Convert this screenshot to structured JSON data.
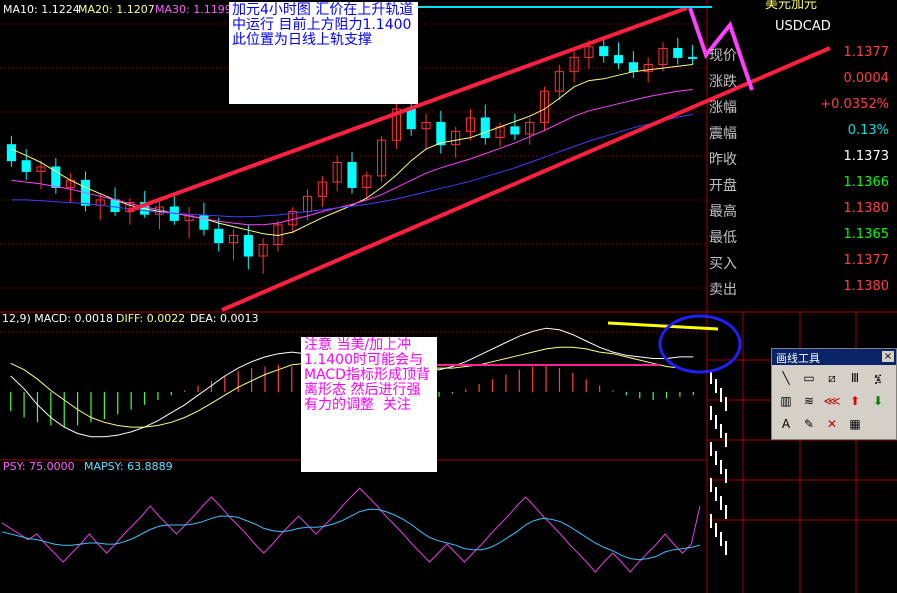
{
  "main_labels": {
    "ma10": "MA10: 1.1224",
    "ma20": "MA20: 1.1207",
    "ma30": "MA30: 1.1199"
  },
  "macd_label": {
    "params": "12,9) MACD: 0.0018",
    "diff": "DIFF: 0.0022",
    "dea": "DEA: 0.0013"
  },
  "psy_label": {
    "psy": "PSY: 75.0000",
    "mapsy": "MAPSY: 63.8889"
  },
  "quote": {
    "title": "美元加元",
    "symbol": "USDCAD",
    "rows": [
      {
        "label": "现价",
        "value": "1.1377",
        "color": "#ff4040"
      },
      {
        "label": "涨跌",
        "value": "0.0004",
        "color": "#ff4040"
      },
      {
        "label": "涨幅",
        "value": "+0.0352%",
        "color": "#ff4040"
      },
      {
        "label": "震幅",
        "value": "0.13%",
        "color": "#00e0e0"
      },
      {
        "label": "昨收",
        "value": "1.1373",
        "color": "#ffffff"
      },
      {
        "label": "开盘",
        "value": "1.1366",
        "color": "#00ff00"
      },
      {
        "label": "最高",
        "value": "1.1380",
        "color": "#ff4040"
      },
      {
        "label": "最低",
        "value": "1.1365",
        "color": "#00ff00"
      },
      {
        "label": "买入",
        "value": "1.1377",
        "color": "#ff4040"
      },
      {
        "label": "卖出",
        "value": "1.1380",
        "color": "#ff4040"
      }
    ]
  },
  "annotations": {
    "top": "加元4小时图 汇价在上升轨道中运行 目前上方阻力1.1400 此位置为日线上轨支撑",
    "bottom": "注意 当美/加上冲1.1400时可能会与MACD指标形成顶背离形态 然后进行强有力的调整  关注"
  },
  "toolbox": {
    "title": "画线工具",
    "close": "×",
    "tools": [
      "line-tool-icon",
      "rect-tool-icon",
      "parallel-tool-icon",
      "bars-tool-icon",
      "fib-tool-icon",
      "gann-tool-icon",
      "channel-tool-icon",
      "fan-tool-icon",
      "up-arrow-icon",
      "down-arrow-icon",
      "text-tool-icon",
      "erase-tool-icon",
      "delete-tool-icon",
      "save-tool-icon"
    ],
    "text_tool": "A"
  },
  "colors": {
    "up_candle": "#ff3030",
    "down_candle": "#00ffff",
    "ma10": "#ffff80",
    "ma20": "#ff40ff",
    "ma30": "#4040ff",
    "trend": "#ff2040",
    "resistance": "#00e0ff",
    "grid": "#8b0000"
  },
  "chart_data": [
    {
      "type": "candlestick",
      "title": "",
      "ylim": [
        1.11,
        1.142
      ],
      "series": [
        {
          "name": "MA10",
          "values": [
            1.1275,
            1.1268,
            1.126,
            1.125,
            1.124,
            1.1232,
            1.1225,
            1.1218,
            1.1212,
            1.1208,
            1.1205,
            1.1203,
            1.12,
            1.1197,
            1.1192,
            1.1188,
            1.1184,
            1.118,
            1.1178,
            1.1182,
            1.119,
            1.1198,
            1.1205,
            1.1212,
            1.122,
            1.1232,
            1.1246,
            1.1262,
            1.1275,
            1.1282,
            1.1285,
            1.1288,
            1.1294,
            1.13,
            1.1306,
            1.1312,
            1.132,
            1.1332,
            1.1345,
            1.1352,
            1.1354,
            1.1358,
            1.1362,
            1.1364,
            1.1366,
            1.1368,
            1.137
          ]
        },
        {
          "name": "MA20",
          "values": [
            1.124,
            1.1238,
            1.1236,
            1.1233,
            1.123,
            1.1226,
            1.1222,
            1.1218,
            1.1214,
            1.121,
            1.1207,
            1.1203,
            1.12,
            1.1197,
            1.1194,
            1.1192,
            1.119,
            1.119,
            1.1192,
            1.1196,
            1.12,
            1.1205,
            1.1209,
            1.1213,
            1.1218,
            1.1224,
            1.1232,
            1.124,
            1.1248,
            1.1254,
            1.1259,
            1.1264,
            1.127,
            1.1276,
            1.1282,
            1.1289,
            1.1296,
            1.1304,
            1.1312,
            1.1318,
            1.1322,
            1.1326,
            1.133,
            1.1334,
            1.1337,
            1.134,
            1.1342
          ]
        },
        {
          "name": "MA30",
          "values": [
            1.1218,
            1.1218,
            1.1217,
            1.1216,
            1.1215,
            1.1214,
            1.1212,
            1.121,
            1.1208,
            1.1206,
            1.1204,
            1.1203,
            1.1202,
            1.1201,
            1.12,
            1.1199,
            1.1199,
            1.12,
            1.1201,
            1.1203,
            1.1205,
            1.1207,
            1.1209,
            1.1211,
            1.1213,
            1.1216,
            1.1219,
            1.1223,
            1.1227,
            1.1231,
            1.1235,
            1.1239,
            1.1244,
            1.1249,
            1.1254,
            1.126,
            1.1266,
            1.1272,
            1.1278,
            1.1284,
            1.1289,
            1.1294,
            1.1299,
            1.1303,
            1.1307,
            1.1311,
            1.1314
          ]
        }
      ],
      "candles": [
        [
          1.128,
          1.129,
          1.1255,
          1.1262
        ],
        [
          1.1262,
          1.1275,
          1.124,
          1.125
        ],
        [
          1.125,
          1.1262,
          1.123,
          1.1255
        ],
        [
          1.1255,
          1.1265,
          1.1225,
          1.1232
        ],
        [
          1.1232,
          1.1248,
          1.1215,
          1.124
        ],
        [
          1.124,
          1.125,
          1.1205,
          1.1212
        ],
        [
          1.1212,
          1.1225,
          1.1195,
          1.1218
        ],
        [
          1.1218,
          1.1232,
          1.12,
          1.1205
        ],
        [
          1.1205,
          1.122,
          1.119,
          1.1215
        ],
        [
          1.1215,
          1.1228,
          1.1198,
          1.1202
        ],
        [
          1.1202,
          1.1218,
          1.1185,
          1.121
        ],
        [
          1.121,
          1.1222,
          1.119,
          1.1195
        ],
        [
          1.1195,
          1.121,
          1.1175,
          1.12
        ],
        [
          1.12,
          1.1215,
          1.1178,
          1.1185
        ],
        [
          1.1185,
          1.1198,
          1.116,
          1.117
        ],
        [
          1.117,
          1.1185,
          1.115,
          1.1178
        ],
        [
          1.1178,
          1.119,
          1.114,
          1.1155
        ],
        [
          1.1155,
          1.1175,
          1.1135,
          1.1168
        ],
        [
          1.1168,
          1.1195,
          1.116,
          1.119
        ],
        [
          1.119,
          1.121,
          1.118,
          1.1205
        ],
        [
          1.1205,
          1.123,
          1.1195,
          1.1222
        ],
        [
          1.1222,
          1.1245,
          1.121,
          1.1238
        ],
        [
          1.1238,
          1.1268,
          1.1228,
          1.126
        ],
        [
          1.126,
          1.1272,
          1.1225,
          1.1232
        ],
        [
          1.1232,
          1.125,
          1.122,
          1.1245
        ],
        [
          1.1245,
          1.129,
          1.1238,
          1.1285
        ],
        [
          1.1285,
          1.133,
          1.1275,
          1.132
        ],
        [
          1.132,
          1.1335,
          1.129,
          1.1298
        ],
        [
          1.1298,
          1.1315,
          1.1275,
          1.1305
        ],
        [
          1.1305,
          1.1318,
          1.127,
          1.128
        ],
        [
          1.128,
          1.13,
          1.1265,
          1.1295
        ],
        [
          1.1295,
          1.132,
          1.1285,
          1.131
        ],
        [
          1.131,
          1.1325,
          1.128,
          1.1288
        ],
        [
          1.1288,
          1.1305,
          1.1278,
          1.13
        ],
        [
          1.13,
          1.1315,
          1.1285,
          1.1292
        ],
        [
          1.1292,
          1.131,
          1.128,
          1.1305
        ],
        [
          1.1305,
          1.1345,
          1.1295,
          1.134
        ],
        [
          1.134,
          1.137,
          1.133,
          1.1362
        ],
        [
          1.1362,
          1.1385,
          1.135,
          1.1378
        ],
        [
          1.1378,
          1.1398,
          1.1365,
          1.139
        ],
        [
          1.139,
          1.1402,
          1.1372,
          1.138
        ],
        [
          1.138,
          1.1395,
          1.1365,
          1.1372
        ],
        [
          1.1372,
          1.1385,
          1.1355,
          1.1362
        ],
        [
          1.1362,
          1.1378,
          1.135,
          1.137
        ],
        [
          1.137,
          1.1395,
          1.1362,
          1.1388
        ],
        [
          1.1388,
          1.14,
          1.137,
          1.1378
        ],
        [
          1.1378,
          1.1392,
          1.137,
          1.1377
        ]
      ],
      "resistance": 1.14
    },
    {
      "type": "bar",
      "title": "",
      "series": [
        {
          "name": "MACD",
          "values": [
            -0.0012,
            -0.0016,
            -0.0019,
            -0.0021,
            -0.0022,
            -0.0021,
            -0.0019,
            -0.0017,
            -0.0014,
            -0.0011,
            -0.0008,
            -0.0005,
            -0.0002,
            0.0001,
            0.0004,
            0.0007,
            0.001,
            0.0013,
            0.0015,
            0.0016,
            0.0017,
            0.0016,
            0.0014,
            0.0011,
            0.0008,
            0.0005,
            0.0003,
            0.0001,
            -0.0001,
            -0.0003,
            -0.0004,
            -0.0004,
            -0.0003,
            -0.0001,
            0.0002,
            0.0005,
            0.0008,
            0.0011,
            0.0014,
            0.0016,
            0.0017,
            0.0015,
            0.0012,
            0.0008,
            0.0004,
            0.0001,
            -0.0002,
            -0.0004,
            -0.0005,
            -0.0004,
            -0.0003,
            -0.0002
          ]
        },
        {
          "name": "DIFF",
          "values": [
            0.001,
            0.0002,
            -0.0008,
            -0.0016,
            -0.0022,
            -0.0026,
            -0.0028,
            -0.0028,
            -0.0027,
            -0.0025,
            -0.0022,
            -0.0018,
            -0.0013,
            -0.0008,
            -0.0002,
            0.0004,
            0.001,
            0.0015,
            0.0019,
            0.0022,
            0.0024,
            0.0025,
            0.0024,
            0.0022,
            0.002,
            0.0018,
            0.0016,
            0.0015,
            0.0014,
            0.0013,
            0.0013,
            0.0013,
            0.0014,
            0.0016,
            0.0019,
            0.0023,
            0.0027,
            0.0031,
            0.0035,
            0.0038,
            0.004,
            0.0039,
            0.0036,
            0.0032,
            0.0028,
            0.0025,
            0.0023,
            0.0022,
            0.0021,
            0.0021,
            0.0022,
            0.0022
          ]
        },
        {
          "name": "DEA",
          "values": [
            0.0018,
            0.0014,
            0.0008,
            0.0001,
            -0.0005,
            -0.0011,
            -0.0016,
            -0.0019,
            -0.0021,
            -0.0022,
            -0.0022,
            -0.0021,
            -0.0019,
            -0.0016,
            -0.0012,
            -0.0007,
            -0.0002,
            0.0003,
            0.0007,
            0.0011,
            0.0014,
            0.0017,
            0.0018,
            0.0019,
            0.0019,
            0.0019,
            0.0018,
            0.0018,
            0.0017,
            0.0016,
            0.0015,
            0.0015,
            0.0015,
            0.0015,
            0.0016,
            0.0017,
            0.0019,
            0.0021,
            0.0023,
            0.0025,
            0.0027,
            0.0028,
            0.0028,
            0.0027,
            0.0025,
            0.0024,
            0.0022,
            0.002,
            0.0018,
            0.0016,
            0.0015,
            0.0013
          ]
        }
      ]
    },
    {
      "type": "line",
      "title": "",
      "ylim": [
        0,
        100
      ],
      "series": [
        {
          "name": "PSY",
          "values": [
            60,
            55,
            50,
            45,
            50,
            41,
            33,
            25,
            33,
            41,
            50,
            41,
            33,
            41,
            50,
            58,
            66,
            75,
            66,
            58,
            50,
            58,
            66,
            75,
            83,
            75,
            66,
            58,
            50,
            41,
            33,
            41,
            50,
            58,
            66,
            58,
            50,
            58,
            66,
            75,
            83,
            91,
            83,
            75,
            66,
            58,
            50,
            41,
            33,
            25,
            33,
            41,
            33,
            25,
            33,
            41,
            50,
            58,
            66,
            75,
            83,
            75,
            66,
            58,
            50,
            41,
            33,
            25,
            16,
            25,
            33,
            25,
            16,
            25,
            33,
            41,
            50,
            41,
            33,
            41,
            75
          ]
        },
        {
          "name": "MAPSY",
          "values": [
            52,
            50,
            48,
            46,
            45,
            43,
            41,
            40,
            40,
            41,
            42,
            42,
            41,
            41,
            43,
            46,
            50,
            54,
            57,
            58,
            58,
            58,
            59,
            61,
            64,
            66,
            66,
            65,
            62,
            59,
            55,
            53,
            52,
            53,
            55,
            56,
            56,
            57,
            59,
            62,
            66,
            70,
            72,
            72,
            70,
            67,
            63,
            58,
            52,
            47,
            44,
            42,
            40,
            37,
            36,
            36,
            38,
            42,
            47,
            52,
            58,
            62,
            64,
            63,
            61,
            57,
            52,
            47,
            42,
            38,
            35,
            31,
            28,
            27,
            28,
            30,
            34,
            36,
            37,
            38,
            40
          ]
        }
      ]
    }
  ]
}
